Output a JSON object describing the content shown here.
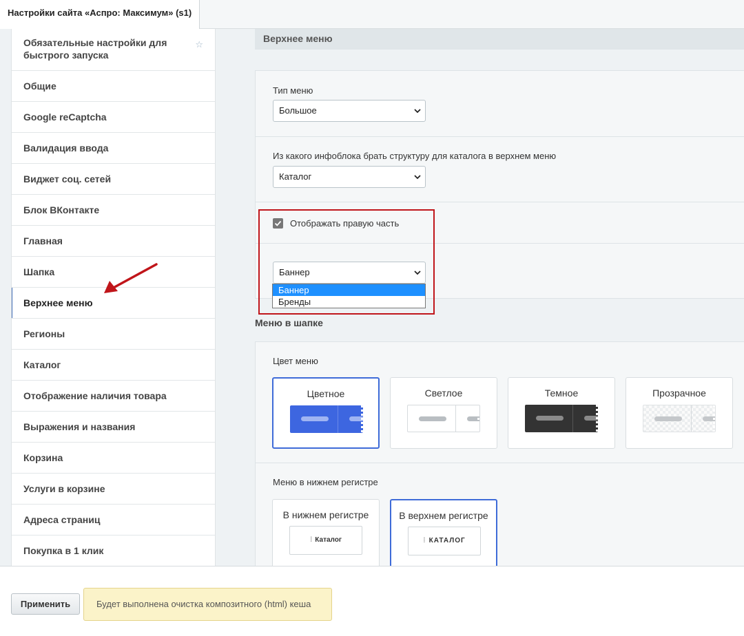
{
  "window": {
    "tab_title": "Настройки сайта «Аспро: Максимум» (s1)"
  },
  "sidebar": {
    "items": [
      {
        "label": "Обязательные настройки для быстрого запуска",
        "starred": true
      },
      {
        "label": "Общие"
      },
      {
        "label": "Google reCaptcha"
      },
      {
        "label": "Валидация ввода"
      },
      {
        "label": "Виджет соц. сетей"
      },
      {
        "label": "Блок ВКонтакте"
      },
      {
        "label": "Главная"
      },
      {
        "label": "Шапка"
      },
      {
        "label": "Верхнее меню",
        "active": true
      },
      {
        "label": "Регионы"
      },
      {
        "label": "Каталог"
      },
      {
        "label": "Отображение наличия товара"
      },
      {
        "label": "Выражения и названия"
      },
      {
        "label": "Корзина"
      },
      {
        "label": "Услуги в корзине"
      },
      {
        "label": "Адреса страниц"
      },
      {
        "label": "Покупка в 1 клик"
      }
    ]
  },
  "main": {
    "section_title": "Верхнее меню",
    "menu_type": {
      "label": "Тип меню",
      "value": "Большое"
    },
    "catalog_source": {
      "label": "Из какого инфоблока брать структуру для каталога в верхнем меню",
      "value": "Каталог"
    },
    "right_part": {
      "label": "Отображать правую часть",
      "checked": true
    },
    "right_part_type": {
      "value": "Баннер",
      "options": [
        "Баннер",
        "Бренды"
      ],
      "highlighted": "Баннер"
    },
    "header_menu": {
      "title": "Меню в шапке",
      "color": {
        "label": "Цвет меню",
        "options": [
          "Цветное",
          "Светлое",
          "Темное",
          "Прозрачное"
        ],
        "selected": "Цветное"
      },
      "case": {
        "label": "Меню в нижнем регистре",
        "options": [
          {
            "label": "В нижнем регистре",
            "sample": "Каталог"
          },
          {
            "label": "В верхнем регистре",
            "sample": "КАТАЛОГ"
          }
        ],
        "selected": "В верхнем регистре"
      }
    }
  },
  "footer": {
    "apply_label": "Применить",
    "notice": "Будет выполнена очистка композитного (html) кеша"
  },
  "colors": {
    "accent": "#3e6bd8",
    "annotation": "#c0151a",
    "select_highlight": "#1e90ff"
  }
}
